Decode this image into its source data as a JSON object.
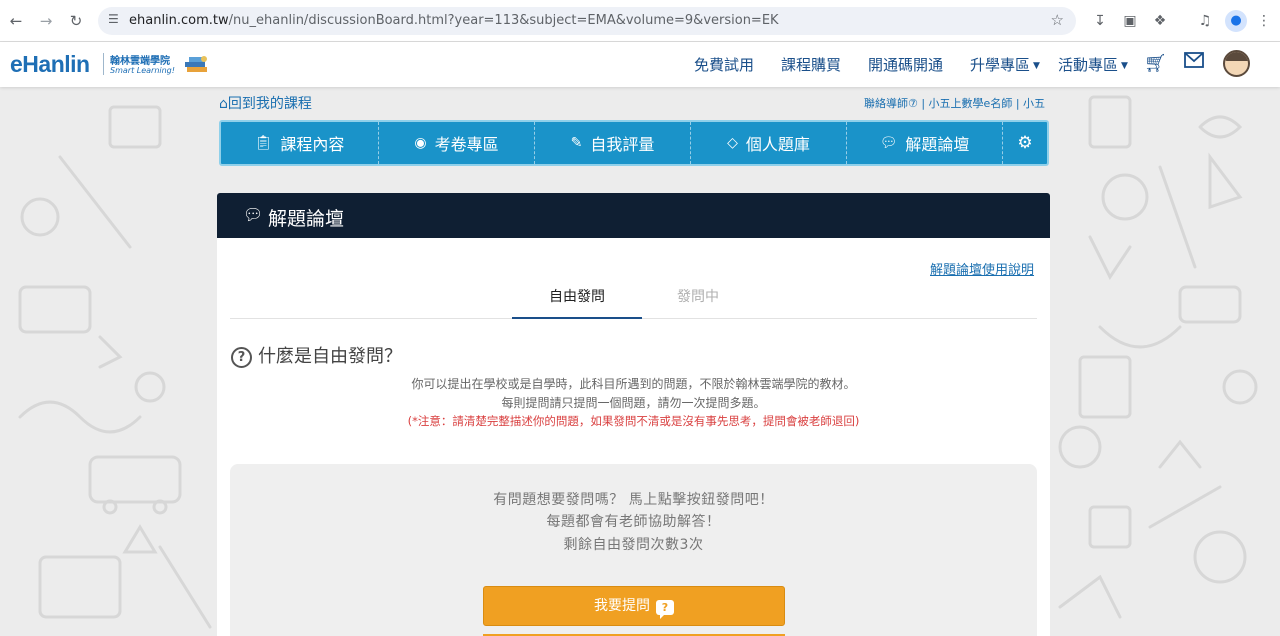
{
  "browser": {
    "url_host": "ehanlin.com.tw",
    "url_rest": "/nu_ehanlin/discussionBoard.html?year=113&subject=EMA&volume=9&version=EK",
    "icons": [
      "back-arrow-icon",
      "forward-arrow-icon",
      "reload-icon",
      "site-info-icon",
      "bookmark-star-icon",
      "download-icon",
      "extension-icon",
      "puzzle-icon",
      "media-icon",
      "profile-icon",
      "kebab-menu-icon"
    ]
  },
  "site": {
    "logo_text": "eHanlin",
    "logo_zh": "翰林雲端學院",
    "logo_en": "Smart Learning!",
    "nav": [
      "免費試用",
      "課程購買",
      "開通碼開通",
      "升學專區",
      "活動專區"
    ],
    "nav_caret_items": [
      "升學專區",
      "活動專區"
    ],
    "colors": {
      "brand": "#1f6fb5",
      "nav_text": "#1a4f8a"
    }
  },
  "breadcrumb": {
    "back_label": "回到我的課程",
    "teacher_info": "聯絡導師⑦ | 小五上數學e名師 | 小五"
  },
  "course_tabs": [
    {
      "label": "課程內容",
      "icon": "clipboard-icon"
    },
    {
      "label": "考卷專區",
      "icon": "helmet-icon"
    },
    {
      "label": "自我評量",
      "icon": "edit-icon"
    },
    {
      "label": "個人題庫",
      "icon": "diamond-icon"
    },
    {
      "label": "解題論壇",
      "icon": "chat-icon"
    },
    {
      "label": "",
      "icon": "gear-icon"
    }
  ],
  "forum": {
    "title": "解題論壇",
    "help_link": "解題論壇使用說明",
    "subtabs": {
      "active": "自由發問",
      "inactive": "發問中"
    },
    "question_heading": "什麼是自由發問？",
    "desc_line1": "你可以提出在學校或是自學時，此科目所遇到的問題，不限於翰林雲端學院的教材。",
    "desc_line2": "每則提問請只提問一個問題，請勿一次提問多題。",
    "desc_note": "(*注意：請清楚完整描述你的問題，如果發問不清或是沒有事先思考，提問會被老師退回)",
    "ask_line1": "有問題想要發問嗎？ 馬上點擊按鈕發問吧！",
    "ask_line2": "每題都會有老師協助解答！",
    "ask_line3": "剩餘自由發問次數3次",
    "ask_button": "我要提問",
    "colors": {
      "header": "#0f1f33",
      "tab_bar": "#1a93c9",
      "button": "#f0a022",
      "note": "#d93f3f"
    }
  }
}
